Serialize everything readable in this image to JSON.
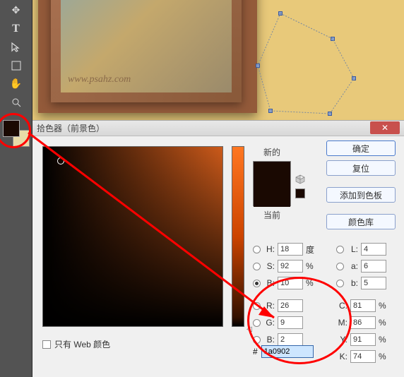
{
  "watermark": "www.psahz.com",
  "dialog": {
    "title": "拾色器（前景色）"
  },
  "labels": {
    "new_color": "新的",
    "current_color": "当前"
  },
  "buttons": {
    "ok": "确定",
    "cancel": "复位",
    "add_swatch": "添加到色板",
    "color_lib": "颜色库"
  },
  "hsb": {
    "h": {
      "label": "H:",
      "value": "18",
      "unit": "度"
    },
    "s": {
      "label": "S:",
      "value": "92",
      "unit": "%"
    },
    "b": {
      "label": "B:",
      "value": "10",
      "unit": "%"
    }
  },
  "rgb": {
    "r": {
      "label": "R:",
      "value": "26"
    },
    "g": {
      "label": "G:",
      "value": "9"
    },
    "b": {
      "label": "B:",
      "value": "2"
    }
  },
  "lab": {
    "l": {
      "label": "L:",
      "value": "4"
    },
    "a": {
      "label": "a:",
      "value": "6"
    },
    "b": {
      "label": "b:",
      "value": "5"
    }
  },
  "cmyk": {
    "c": {
      "label": "C:",
      "value": "81",
      "unit": "%"
    },
    "m": {
      "label": "M:",
      "value": "86",
      "unit": "%"
    },
    "y": {
      "label": "Y:",
      "value": "91",
      "unit": "%"
    },
    "k": {
      "label": "K:",
      "value": "74",
      "unit": "%"
    }
  },
  "hex": {
    "label": "#",
    "value": "1a0902"
  },
  "web_only": "只有 Web 颜色",
  "colors": {
    "preview_new": "#1a0902",
    "preview_current": "#1a0902",
    "annotation": "#ff0000"
  }
}
